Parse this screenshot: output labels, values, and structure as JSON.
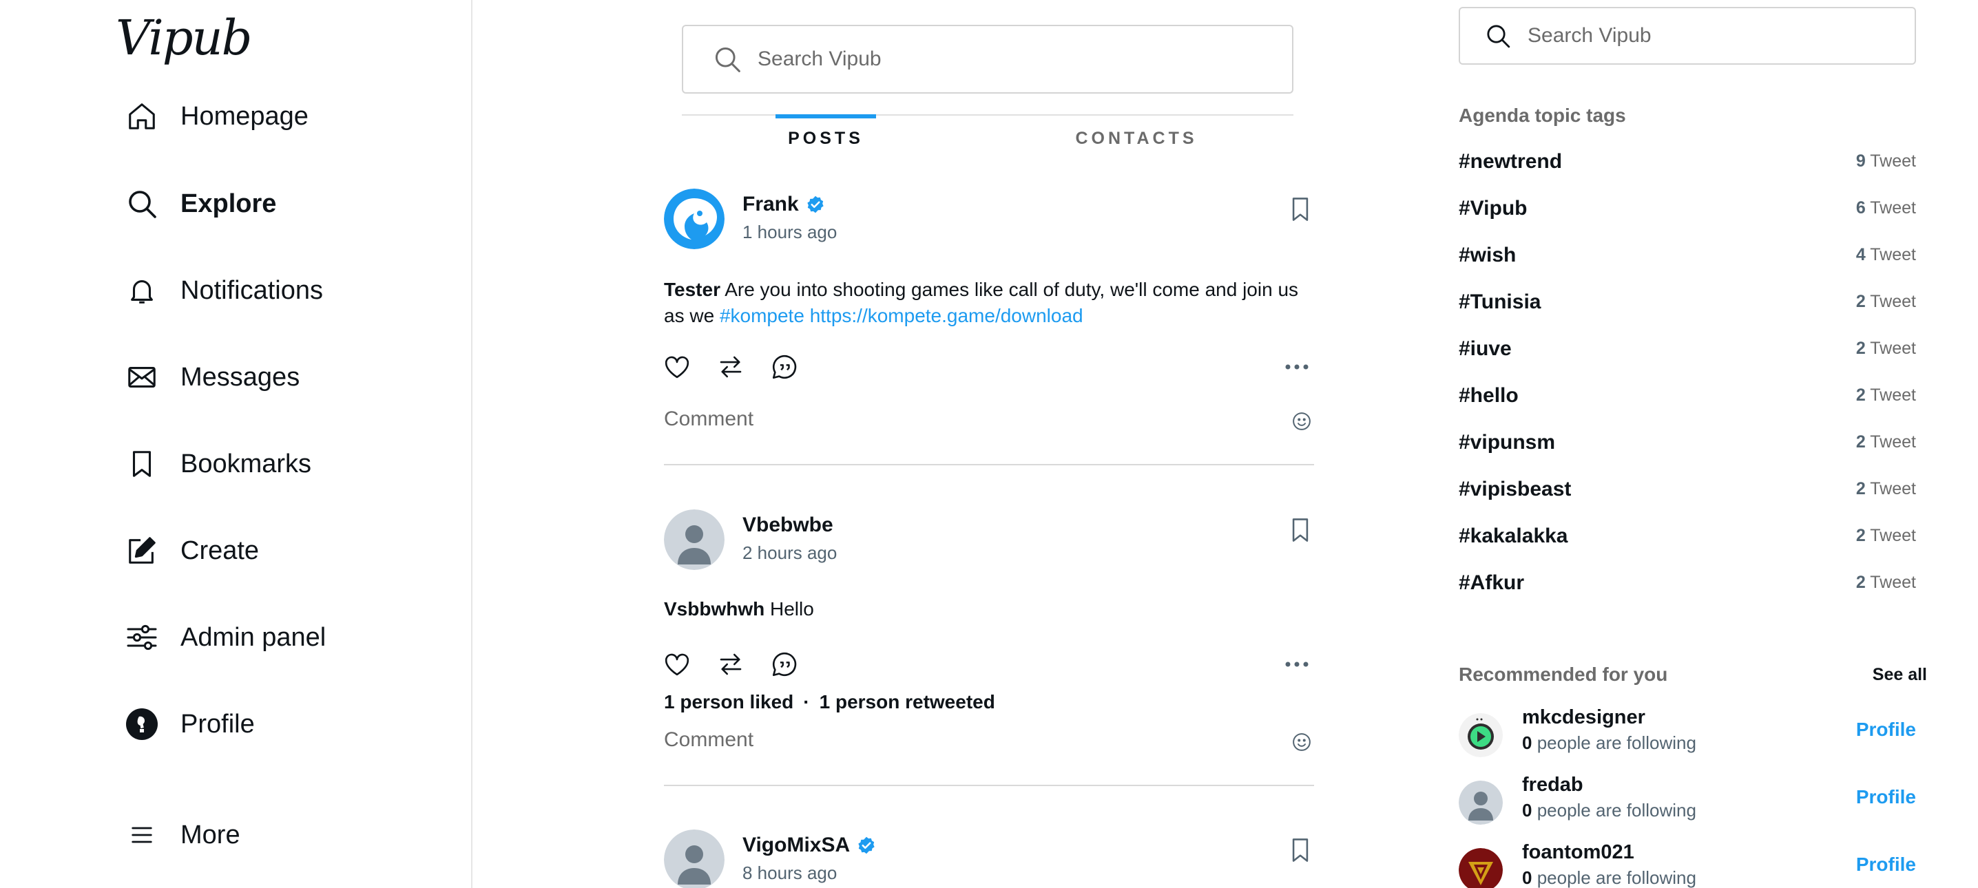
{
  "app": {
    "logo": "Vipub"
  },
  "sidebar": {
    "items": [
      {
        "label": "Homepage",
        "icon": "home-icon"
      },
      {
        "label": "Explore",
        "icon": "search-icon",
        "active": true
      },
      {
        "label": "Notifications",
        "icon": "bell-icon"
      },
      {
        "label": "Messages",
        "icon": "envelope-icon"
      },
      {
        "label": "Bookmarks",
        "icon": "bookmark-icon"
      },
      {
        "label": "Create",
        "icon": "edit-icon"
      },
      {
        "label": "Admin panel",
        "icon": "sliders-icon"
      },
      {
        "label": "Profile",
        "icon": "avatar-icon"
      },
      {
        "label": "More",
        "icon": "menu-icon"
      }
    ]
  },
  "feed": {
    "search_placeholder": "Search Vipub",
    "tabs": {
      "posts": "POSTS",
      "contacts": "CONTACTS"
    },
    "comment_placeholder": "Comment",
    "posts": [
      {
        "author": "Frank",
        "verified": true,
        "time": "1 hours ago",
        "text_bold": "Tester",
        "text_line1": " Are you into shooting games like call of duty, we'll come and join us",
        "text_line2_prefix": "as we ",
        "hashtag": "#kompete",
        "url": "https://kompete.game/download"
      },
      {
        "author": "Vbebwbe",
        "verified": false,
        "time": "2 hours ago",
        "text_bold": "Vsbbwhwh",
        "text_rest": " Hello",
        "likes": "1 person liked",
        "sep": "·",
        "retweets": "1 person retweeted"
      },
      {
        "author": "VigoMixSA",
        "verified": true,
        "time": "8 hours ago"
      }
    ]
  },
  "right": {
    "search_placeholder": "Search Vipub",
    "tags_title": "Agenda topic tags",
    "tags": [
      {
        "tag": "#newtrend",
        "count": "9",
        "unit": " Tweet"
      },
      {
        "tag": "#Vipub",
        "count": "6",
        "unit": " Tweet"
      },
      {
        "tag": "#wish",
        "count": "4",
        "unit": " Tweet"
      },
      {
        "tag": "#Tunisia",
        "count": "2",
        "unit": " Tweet"
      },
      {
        "tag": "#iuve",
        "count": "2",
        "unit": " Tweet"
      },
      {
        "tag": "#hello",
        "count": "2",
        "unit": " Tweet"
      },
      {
        "tag": "#vipunsm",
        "count": "2",
        "unit": " Tweet"
      },
      {
        "tag": "#vipisbeast",
        "count": "2",
        "unit": " Tweet"
      },
      {
        "tag": "#kakalakka",
        "count": "2",
        "unit": " Tweet"
      },
      {
        "tag": "#Afkur",
        "count": "2",
        "unit": " Tweet"
      }
    ],
    "rec_title": "Recommended for you",
    "see_all": "See all",
    "recommended": [
      {
        "name": "mkcdesigner",
        "count": "0",
        "sub": " people are following",
        "button": "Profile"
      },
      {
        "name": "fredab",
        "count": "0",
        "sub": " people are following",
        "button": "Profile"
      },
      {
        "name": "foantom021",
        "count": "0",
        "sub": " people are following",
        "button": "Profile"
      }
    ]
  },
  "colors": {
    "accent": "#1d9bf0",
    "text": "#0f1419",
    "muted": "#536471",
    "border": "#d9d9d9"
  }
}
